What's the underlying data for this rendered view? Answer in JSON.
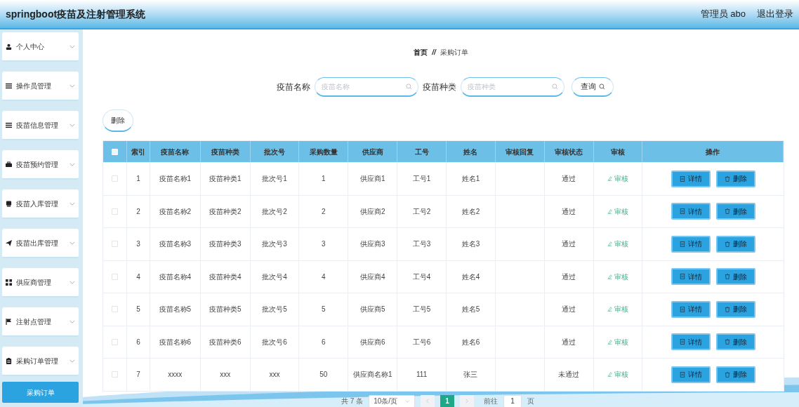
{
  "header": {
    "title": "springboot疫苗及注射管理系统",
    "user": "管理员 abo",
    "logout": "退出登录"
  },
  "sidebar": {
    "items": [
      {
        "label": "个人中心"
      },
      {
        "label": "操作员管理"
      },
      {
        "label": "疫苗信息管理"
      },
      {
        "label": "疫苗预约管理"
      },
      {
        "label": "疫苗入库管理"
      },
      {
        "label": "疫苗出库管理"
      },
      {
        "label": "供应商管理"
      },
      {
        "label": "注射点管理"
      },
      {
        "label": "采购订单管理",
        "children": [
          {
            "label": "采购订单",
            "selected": true
          }
        ]
      }
    ]
  },
  "breadcrumb": {
    "home": "首页",
    "separator": "//",
    "current": "采购订单"
  },
  "search": {
    "fields": [
      {
        "label": "疫苗名称",
        "placeholder": "疫苗名称"
      },
      {
        "label": "疫苗种类",
        "placeholder": "疫苗种类"
      }
    ],
    "button": "查询"
  },
  "delete_button": "删除",
  "table": {
    "all_checked": false,
    "columns": [
      "索引",
      "疫苗名称",
      "疫苗种类",
      "批次号",
      "采购数量",
      "供应商",
      "工号",
      "姓名",
      "审核回复",
      "审核状态",
      "审核",
      "操作"
    ],
    "rows": [
      {
        "checked": false,
        "cells": [
          "1",
          "疫苗名称1",
          "疫苗种类1",
          "批次号1",
          "1",
          "供应商1",
          "工号1",
          "姓名1",
          "",
          "通过"
        ],
        "review": "审核",
        "actions": [
          "详情",
          "删除"
        ]
      },
      {
        "checked": false,
        "cells": [
          "2",
          "疫苗名称2",
          "疫苗种类2",
          "批次号2",
          "2",
          "供应商2",
          "工号2",
          "姓名2",
          "",
          "通过"
        ],
        "review": "审核",
        "actions": [
          "详情",
          "删除"
        ]
      },
      {
        "checked": false,
        "cells": [
          "3",
          "疫苗名称3",
          "疫苗种类3",
          "批次号3",
          "3",
          "供应商3",
          "工号3",
          "姓名3",
          "",
          "通过"
        ],
        "review": "审核",
        "actions": [
          "详情",
          "删除"
        ]
      },
      {
        "checked": false,
        "cells": [
          "4",
          "疫苗名称4",
          "疫苗种类4",
          "批次号4",
          "4",
          "供应商4",
          "工号4",
          "姓名4",
          "",
          "通过"
        ],
        "review": "审核",
        "actions": [
          "详情",
          "删除"
        ]
      },
      {
        "checked": false,
        "cells": [
          "5",
          "疫苗名称5",
          "疫苗种类5",
          "批次号5",
          "5",
          "供应商5",
          "工号5",
          "姓名5",
          "",
          "通过"
        ],
        "review": "审核",
        "actions": [
          "详情",
          "删除"
        ]
      },
      {
        "checked": false,
        "cells": [
          "6",
          "疫苗名称6",
          "疫苗种类6",
          "批次号6",
          "6",
          "供应商6",
          "工号6",
          "姓名6",
          "",
          "通过"
        ],
        "review": "审核",
        "actions": [
          "详情",
          "删除"
        ]
      },
      {
        "checked": false,
        "cells": [
          "7",
          "xxxx",
          "xxx",
          "xxx",
          "50",
          "供应商名称1",
          "111",
          "张三",
          "",
          "未通过"
        ],
        "review": "审核",
        "actions": [
          "详情",
          "删除"
        ]
      }
    ]
  },
  "pagination": {
    "total": "共 7 条",
    "page_size": "10条/页",
    "pages": [
      {
        "label": "1",
        "selected": true
      }
    ],
    "goto_label": "前往",
    "goto_value": "1",
    "goto_suffix": "页"
  }
}
